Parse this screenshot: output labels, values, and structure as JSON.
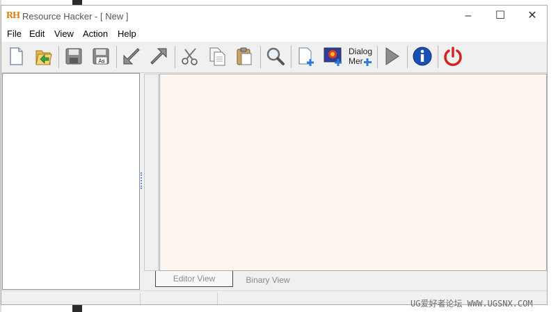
{
  "window": {
    "logo": "RH",
    "title": "Resource Hacker - [ New ]",
    "minimize_glyph": "–",
    "maximize_glyph": "☐",
    "close_glyph": "✕"
  },
  "menu": [
    {
      "label": "File"
    },
    {
      "label": "Edit"
    },
    {
      "label": "View"
    },
    {
      "label": "Action"
    },
    {
      "label": "Help"
    }
  ],
  "toolbar": {
    "items": [
      {
        "icon": "new-file-icon"
      },
      {
        "icon": "open-folder-icon"
      },
      {
        "icon": "save-icon"
      },
      {
        "icon": "save-as-icon",
        "badge": "As"
      },
      {
        "icon": "import-arrow-icon"
      },
      {
        "icon": "export-arrow-icon"
      },
      {
        "icon": "cut-icon"
      },
      {
        "icon": "copy-icon"
      },
      {
        "icon": "paste-icon"
      },
      {
        "icon": "search-icon"
      },
      {
        "icon": "add-resource-icon"
      },
      {
        "icon": "add-image-resource-icon"
      },
      {
        "icon": "dialog-menu-icon",
        "line1": "Dialog",
        "line2": "Mer"
      },
      {
        "icon": "play-icon"
      },
      {
        "icon": "info-icon"
      },
      {
        "icon": "power-icon"
      }
    ],
    "colors": {
      "info": "#1a4fb5",
      "power": "#d92020",
      "plus": "#2b7cd3"
    }
  },
  "tabs": [
    {
      "label": "Editor View",
      "active": true
    },
    {
      "label": "Binary View",
      "active": false
    }
  ],
  "watermark": "UG爱好者论坛 WWW.UGSNX.COM"
}
